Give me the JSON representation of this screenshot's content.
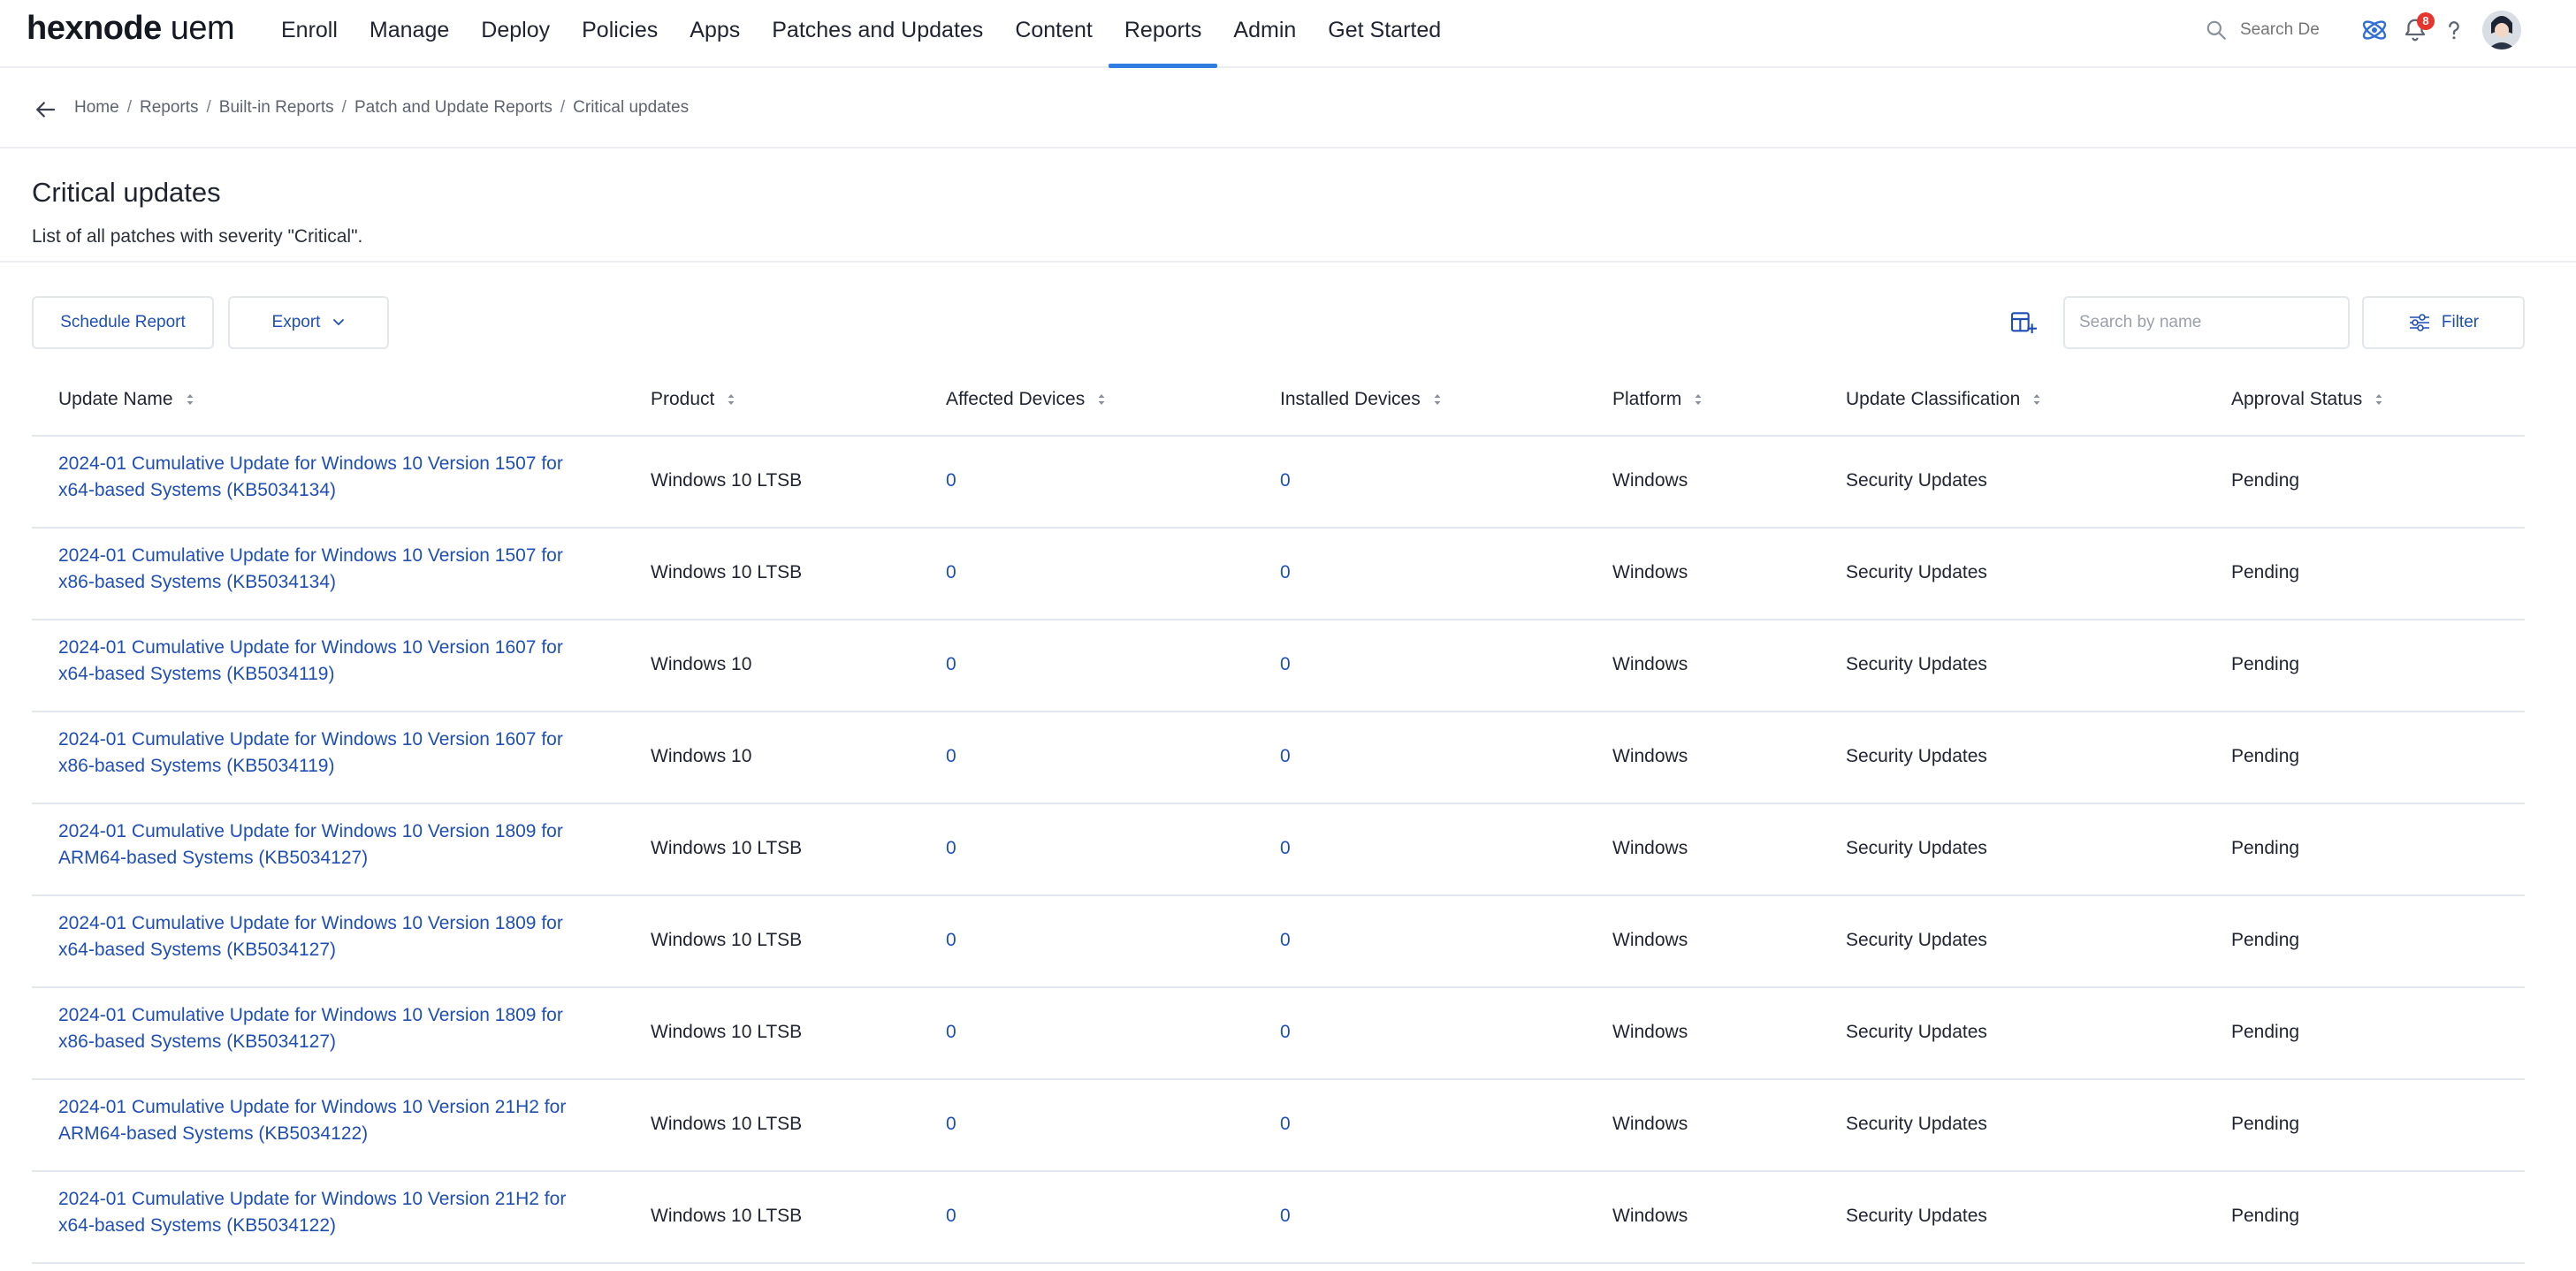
{
  "nav": {
    "logo_brand": "hexnode",
    "logo_product": "uem",
    "items": [
      "Enroll",
      "Manage",
      "Deploy",
      "Policies",
      "Apps",
      "Patches and Updates",
      "Content",
      "Reports",
      "Admin",
      "Get Started"
    ],
    "active": "Reports",
    "search_placeholder": "Search De",
    "notification_count": "8",
    "icons": [
      "search-icon",
      "hexnode-atom-icon",
      "bell-icon",
      "help-icon",
      "avatar"
    ],
    "accent_color": "#2f7de1"
  },
  "breadcrumb": [
    "Home",
    "Reports",
    "Built-in Reports",
    "Patch and Update Reports",
    "Critical updates"
  ],
  "page": {
    "title": "Critical updates",
    "description": "List of all patches with severity \"Critical\"."
  },
  "toolbar": {
    "schedule_label": "Schedule Report",
    "export_label": "Export",
    "search_placeholder": "Search by name",
    "filter_label": "Filter",
    "link_color": "#1f4fb5"
  },
  "table": {
    "columns": [
      "Update Name",
      "Product",
      "Affected Devices",
      "Installed Devices",
      "Platform",
      "Update Classification",
      "Approval Status"
    ],
    "rows": [
      {
        "name_l1": "2024-01 Cumulative Update for Windows 10 Version 1507 for",
        "name_l2": "x64-based Systems (KB5034134)",
        "product": "Windows 10 LTSB",
        "affected": "0",
        "installed": "0",
        "platform": "Windows",
        "classification": "Security Updates",
        "status": "Pending"
      },
      {
        "name_l1": "2024-01 Cumulative Update for Windows 10 Version 1507 for",
        "name_l2": "x86-based Systems (KB5034134)",
        "product": "Windows 10 LTSB",
        "affected": "0",
        "installed": "0",
        "platform": "Windows",
        "classification": "Security Updates",
        "status": "Pending"
      },
      {
        "name_l1": "2024-01 Cumulative Update for Windows 10 Version 1607 for",
        "name_l2": "x64-based Systems (KB5034119)",
        "product": "Windows 10",
        "affected": "0",
        "installed": "0",
        "platform": "Windows",
        "classification": "Security Updates",
        "status": "Pending"
      },
      {
        "name_l1": "2024-01 Cumulative Update for Windows 10 Version 1607 for",
        "name_l2": "x86-based Systems (KB5034119)",
        "product": "Windows 10",
        "affected": "0",
        "installed": "0",
        "platform": "Windows",
        "classification": "Security Updates",
        "status": "Pending"
      },
      {
        "name_l1": "2024-01 Cumulative Update for Windows 10 Version 1809 for",
        "name_l2": "ARM64-based Systems (KB5034127)",
        "product": "Windows 10 LTSB",
        "affected": "0",
        "installed": "0",
        "platform": "Windows",
        "classification": "Security Updates",
        "status": "Pending"
      },
      {
        "name_l1": "2024-01 Cumulative Update for Windows 10 Version 1809 for",
        "name_l2": "x64-based Systems (KB5034127)",
        "product": "Windows 10 LTSB",
        "affected": "0",
        "installed": "0",
        "platform": "Windows",
        "classification": "Security Updates",
        "status": "Pending"
      },
      {
        "name_l1": "2024-01 Cumulative Update for Windows 10 Version 1809 for",
        "name_l2": "x86-based Systems (KB5034127)",
        "product": "Windows 10 LTSB",
        "affected": "0",
        "installed": "0",
        "platform": "Windows",
        "classification": "Security Updates",
        "status": "Pending"
      },
      {
        "name_l1": "2024-01 Cumulative Update for Windows 10 Version 21H2 for",
        "name_l2": "ARM64-based Systems (KB5034122)",
        "product": "Windows 10 LTSB",
        "affected": "0",
        "installed": "0",
        "platform": "Windows",
        "classification": "Security Updates",
        "status": "Pending"
      },
      {
        "name_l1": "2024-01 Cumulative Update for Windows 10 Version 21H2 for",
        "name_l2": "x64-based Systems (KB5034122)",
        "product": "Windows 10 LTSB",
        "affected": "0",
        "installed": "0",
        "platform": "Windows",
        "classification": "Security Updates",
        "status": "Pending"
      }
    ]
  }
}
